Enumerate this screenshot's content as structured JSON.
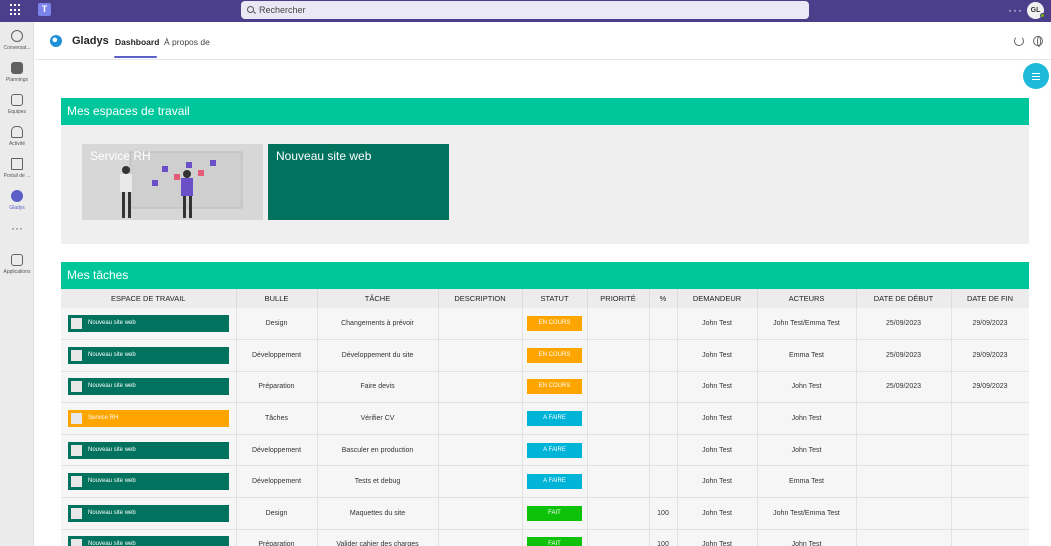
{
  "topbar": {
    "search_placeholder": "Rechercher",
    "more": "···",
    "avatar_initials": "GL"
  },
  "rail": [
    {
      "label": "Conversat...",
      "icon": "chat-icon"
    },
    {
      "label": "Plannings",
      "icon": "planner-icon"
    },
    {
      "label": "Equipes",
      "icon": "teams-icon"
    },
    {
      "label": "Activité",
      "icon": "bell-icon"
    },
    {
      "label": "Portail de ...",
      "icon": "portal-icon"
    },
    {
      "label": "Gladys",
      "icon": "gladys-icon",
      "active": true
    },
    {
      "label": "···",
      "icon": "more-icon"
    },
    {
      "label": "Applications",
      "icon": "apps-icon"
    }
  ],
  "app": {
    "name": "Gladys",
    "tabs": [
      "Dashboard",
      "À propos de"
    ]
  },
  "workspaces": {
    "title": "Mes espaces de travail",
    "cards": [
      {
        "label": "Service RH",
        "color": "#d7d7d7"
      },
      {
        "label": "Nouveau site web",
        "color": "#00725e"
      }
    ]
  },
  "tasks": {
    "title": "Mes tâches",
    "columns": [
      "ESPACE DE TRAVAIL",
      "BULLE",
      "TÂCHE",
      "DESCRIPTION",
      "STATUT",
      "PRIORITÉ",
      "%",
      "DEMANDEUR",
      "ACTEURS",
      "DATE DE DÉBUT",
      "DATE DE FIN"
    ],
    "rows": [
      {
        "workspace": "Nouveau site web",
        "ws_color": "green",
        "bulle": "Design",
        "tache": "Changements à prévoir",
        "description": "",
        "statut": "EN COURS",
        "status_kind": "encours",
        "priorite": "",
        "pct": "",
        "demandeur": "John Test",
        "acteurs": "John Test/Emma Test",
        "debut": "25/09/2023",
        "fin": "29/09/2023"
      },
      {
        "workspace": "Nouveau site web",
        "ws_color": "green",
        "bulle": "Développement",
        "tache": "Développement du site",
        "description": "",
        "statut": "EN COURS",
        "status_kind": "encours",
        "priorite": "",
        "pct": "",
        "demandeur": "John Test",
        "acteurs": "Emma Test",
        "debut": "25/09/2023",
        "fin": "29/09/2023"
      },
      {
        "workspace": "Nouveau site web",
        "ws_color": "green",
        "bulle": "Préparation",
        "tache": "Faire devis",
        "description": "",
        "statut": "EN COURS",
        "status_kind": "encours",
        "priorite": "",
        "pct": "",
        "demandeur": "John Test",
        "acteurs": "John Test",
        "debut": "25/09/2023",
        "fin": "29/09/2023"
      },
      {
        "workspace": "Service RH",
        "ws_color": "orange",
        "bulle": "Tâches",
        "tache": "Vérifier CV",
        "description": "",
        "statut": "A FAIRE",
        "status_kind": "afaire",
        "priorite": "",
        "pct": "",
        "demandeur": "John Test",
        "acteurs": "John Test",
        "debut": "",
        "fin": ""
      },
      {
        "workspace": "Nouveau site web",
        "ws_color": "green",
        "bulle": "Développement",
        "tache": "Basculer en production",
        "description": "",
        "statut": "A FAIRE",
        "status_kind": "afaire",
        "priorite": "",
        "pct": "",
        "demandeur": "John Test",
        "acteurs": "John Test",
        "debut": "",
        "fin": ""
      },
      {
        "workspace": "Nouveau site web",
        "ws_color": "green",
        "bulle": "Développement",
        "tache": "Tests et debug",
        "description": "",
        "statut": "A FAIRE",
        "status_kind": "afaire",
        "priorite": "",
        "pct": "",
        "demandeur": "John Test",
        "acteurs": "Emma Test",
        "debut": "",
        "fin": ""
      },
      {
        "workspace": "Nouveau site web",
        "ws_color": "green",
        "bulle": "Design",
        "tache": "Maquettes du site",
        "description": "",
        "statut": "FAIT",
        "status_kind": "fait",
        "priorite": "",
        "pct": "100",
        "demandeur": "John Test",
        "acteurs": "John Test/Emma Test",
        "debut": "",
        "fin": ""
      },
      {
        "workspace": "Nouveau site web",
        "ws_color": "green",
        "bulle": "Préparation",
        "tache": "Valider cahier des charges",
        "description": "",
        "statut": "FAIT",
        "status_kind": "fait",
        "priorite": "",
        "pct": "100",
        "demandeur": "John Test",
        "acteurs": "John Test",
        "debut": "",
        "fin": ""
      }
    ]
  },
  "colors": {
    "topbar": "#4b3f8c",
    "accent": "#00c79b",
    "workspace_green": "#00725e",
    "workspace_orange": "#ffa500",
    "status_encours": "#ffa500",
    "status_afaire": "#00b4d8",
    "status_fait": "#0ec20a"
  }
}
